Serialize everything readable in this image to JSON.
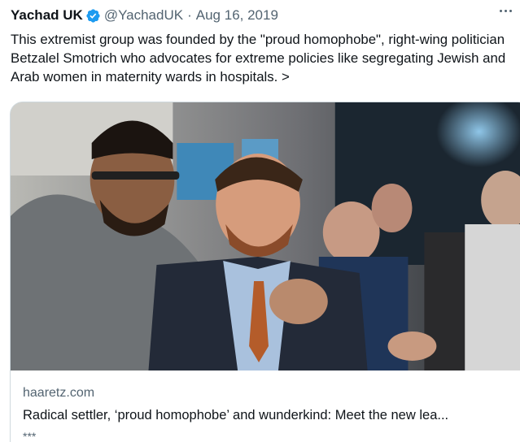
{
  "tweet": {
    "author_name": "Yachad UK",
    "handle": "@YachadUK",
    "separator": "·",
    "date": "Aug 16, 2019",
    "text": "This extremist group was founded by the \"proud homophobe\", right-wing politician Betzalel Smotrich who advocates for extreme policies like segregating Jewish and Arab women in maternity wards in hospitals. >"
  },
  "icons": {
    "verified": "verified-badge-icon",
    "more": "more-options-icon"
  },
  "colors": {
    "verified_blue": "#1d9bf0",
    "text_primary": "#0f1419",
    "text_secondary": "#536471",
    "card_border": "#cfd9de"
  },
  "card": {
    "domain": "haaretz.com",
    "title": "Radical settler, ‘proud homophobe’ and wunderkind: Meet the new lea...",
    "description": "***"
  }
}
